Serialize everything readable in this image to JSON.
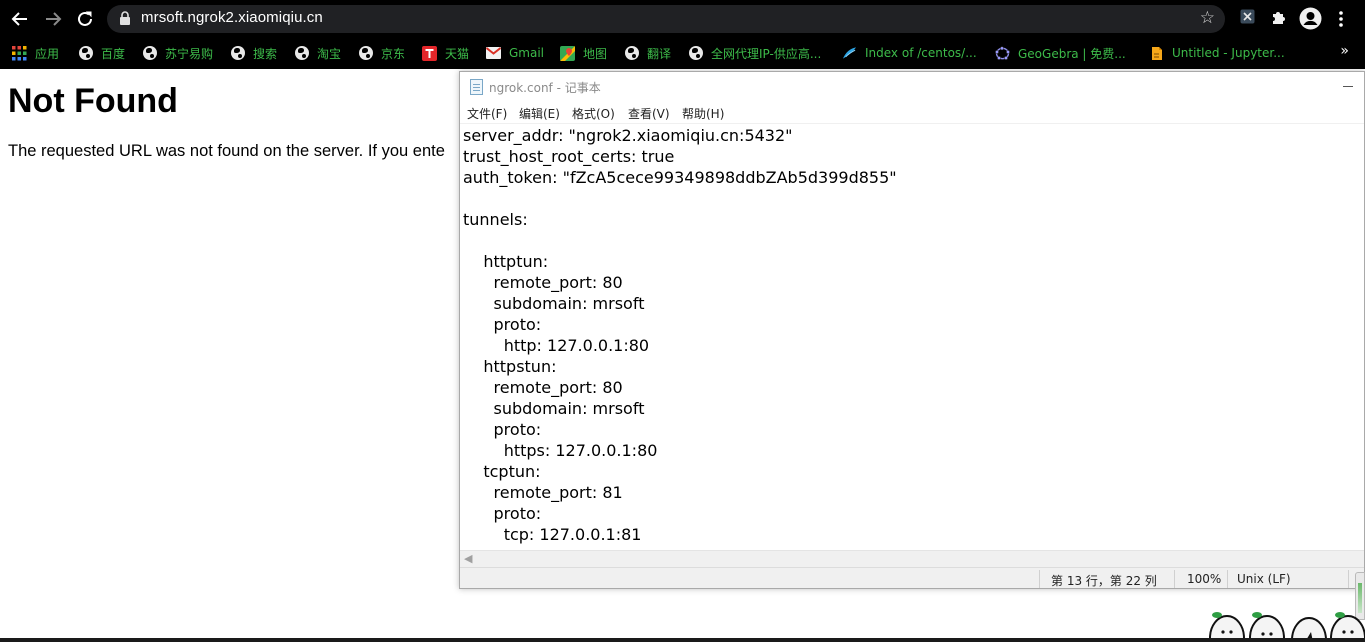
{
  "browser": {
    "url": "mrsoft.ngrok2.xiaomiqiu.cn",
    "bookmarks": [
      {
        "label": "应用",
        "icon": "apps-grid-icon"
      },
      {
        "label": "百度",
        "icon": "globe-icon"
      },
      {
        "label": "苏宁易购",
        "icon": "globe-icon"
      },
      {
        "label": "搜索",
        "icon": "globe-icon"
      },
      {
        "label": "淘宝",
        "icon": "globe-icon"
      },
      {
        "label": "京东",
        "icon": "globe-icon"
      },
      {
        "label": "天猫",
        "icon": "tmall-icon"
      },
      {
        "label": "Gmail",
        "icon": "gmail-icon"
      },
      {
        "label": "地图",
        "icon": "maps-icon"
      },
      {
        "label": "翻译",
        "icon": "globe-icon"
      },
      {
        "label": "全网代理IP-供应高...",
        "icon": "globe-icon"
      },
      {
        "label": "Index of /centos/...",
        "icon": "centos-icon"
      },
      {
        "label": "GeoGebra | 免费...",
        "icon": "geogebra-icon"
      },
      {
        "label": "Untitled - Jupyter...",
        "icon": "jupyter-icon"
      }
    ],
    "overflow_label": "»"
  },
  "page": {
    "title": "Not Found",
    "message": "The requested URL was not found on the server. If you ente"
  },
  "notepad": {
    "title": "ngrok.conf - 记事本",
    "menu": [
      "文件(F)",
      "编辑(E)",
      "格式(O)",
      "查看(V)",
      "帮助(H)"
    ],
    "content": "server_addr: \"ngrok2.xiaomiqiu.cn:5432\"\ntrust_host_root_certs: true\nauth_token: \"fZcA5cece99349898ddbZAb5d399d855\"\n\ntunnels:\n\n    httptun:\n      remote_port: 80\n      subdomain: mrsoft\n      proto:\n        http: 127.0.0.1:80\n    httpstun:\n      remote_port: 80\n      subdomain: mrsoft\n      proto:\n        https: 127.0.0.1:80\n    tcptun:\n      remote_port: 81\n      proto:\n        tcp: 127.0.0.1:81",
    "status": {
      "position": "第 13 行，第 22 列",
      "zoom": "100%",
      "line_ending": "Unix (LF)"
    }
  },
  "colors": {
    "bookmark_text": "#3dbb4a",
    "chrome_bg": "#000000",
    "omnibox_bg": "#202124"
  }
}
